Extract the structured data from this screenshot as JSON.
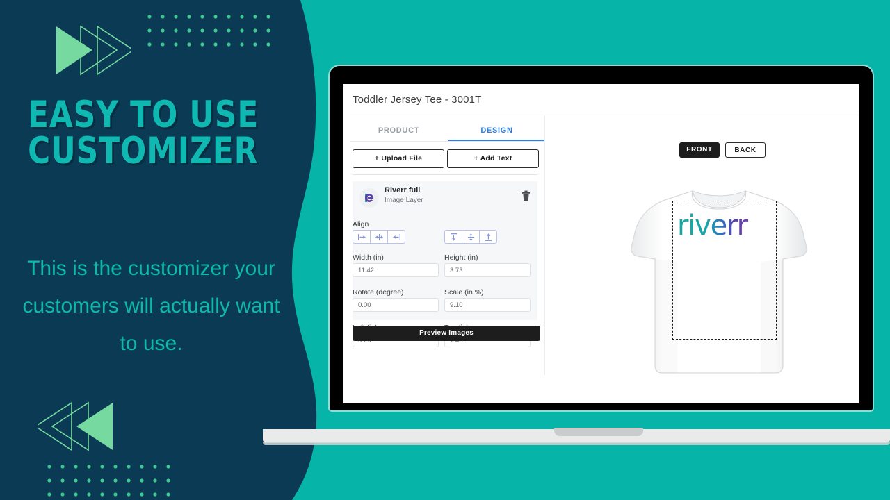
{
  "colors": {
    "navy": "#0a3a54",
    "teal": "#06b5a8",
    "headline_teal": "#0fb9b1",
    "mint": "#76d9a0",
    "accent_blue": "#2e7ce4",
    "dark_button": "#1d1d1d",
    "logo_start": "#1aa9a3",
    "logo_end": "#6b3fb5"
  },
  "promo": {
    "headline_line1": "EASY TO USE",
    "headline_line2": "CUSTOMIZER",
    "subheadline": "This is the customizer your customers will actually want to use.",
    "decor_top_icon": "double-chevron-right-icon",
    "decor_bottom_icon": "double-chevron-left-icon",
    "dot_grid_columns": 10,
    "dot_grid_rows": 3
  },
  "app": {
    "title": "Toddler Jersey Tee - 3001T",
    "tabs": [
      {
        "label": "PRODUCT",
        "active": false
      },
      {
        "label": "DESIGN",
        "active": true
      }
    ],
    "actions": {
      "upload_label": "+ Upload File",
      "add_text_label": "+ Add Text"
    },
    "layer": {
      "name": "Riverr full",
      "type": "Image Layer",
      "thumbnail_icon": "riverr-monogram-icon",
      "delete_icon": "trash-icon"
    },
    "properties": {
      "align_label": "Align",
      "align_horizontal": [
        {
          "icon": "align-left-icon"
        },
        {
          "icon": "align-center-icon"
        },
        {
          "icon": "align-right-icon"
        }
      ],
      "align_vertical": [
        {
          "icon": "align-top-icon"
        },
        {
          "icon": "align-middle-icon"
        },
        {
          "icon": "align-bottom-icon"
        }
      ],
      "fields": [
        {
          "label": "Width (in)",
          "value": "11.42"
        },
        {
          "label": "Height (in)",
          "value": "3.73"
        },
        {
          "label": "Rotate (degree)",
          "value": "0.00"
        },
        {
          "label": "Scale (in %)",
          "value": "9.10"
        },
        {
          "label": "Left (in)",
          "value": "0.29"
        },
        {
          "label": "Top (in)",
          "value": "1.40"
        }
      ]
    },
    "preview_button_label": "Preview Images",
    "view_buttons": [
      {
        "label": "FRONT",
        "active": true
      },
      {
        "label": "BACK",
        "active": false
      }
    ],
    "canvas": {
      "product_icon": "tshirt-icon",
      "print_area_icon": "dashed-print-area-icon",
      "artwork_text": "riverr"
    }
  }
}
